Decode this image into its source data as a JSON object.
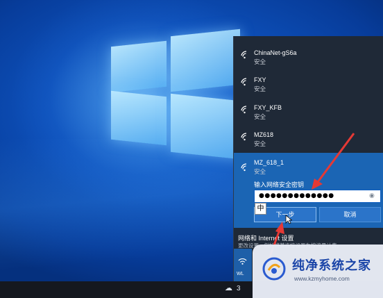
{
  "networks": [
    {
      "name": "ChinaNet-gS6a",
      "status": "安全"
    },
    {
      "name": "FXY",
      "status": "安全"
    },
    {
      "name": "FXY_KFB",
      "status": "安全"
    },
    {
      "name": "MZ618",
      "status": "安全"
    },
    {
      "name": "MZ_618_1",
      "status": "安全"
    }
  ],
  "connect": {
    "password_label": "输入网络安全密钥",
    "password_value": "●●●●●●●●●●●●●",
    "reveal_icon": "eye-icon",
    "next_label": "下一步",
    "cancel_label": "取消",
    "ime_label": "中"
  },
  "settings": {
    "title": "网络和 Internet 设置",
    "subtitle": "更改设置，例如将某连接设置为按流量计费。"
  },
  "quick_tile": {
    "label": "WL"
  },
  "taskbar": {
    "tray_text": "3"
  },
  "watermark": {
    "title": "纯净系统之家",
    "url": "www.kzmyhome.com"
  },
  "colors": {
    "flyout_bg": "#1f2937",
    "selected_bg": "#1b65b4",
    "button_bg": "#2b74c9",
    "annotation_arrow": "#e53935",
    "watermark_text": "#1b45a8"
  }
}
